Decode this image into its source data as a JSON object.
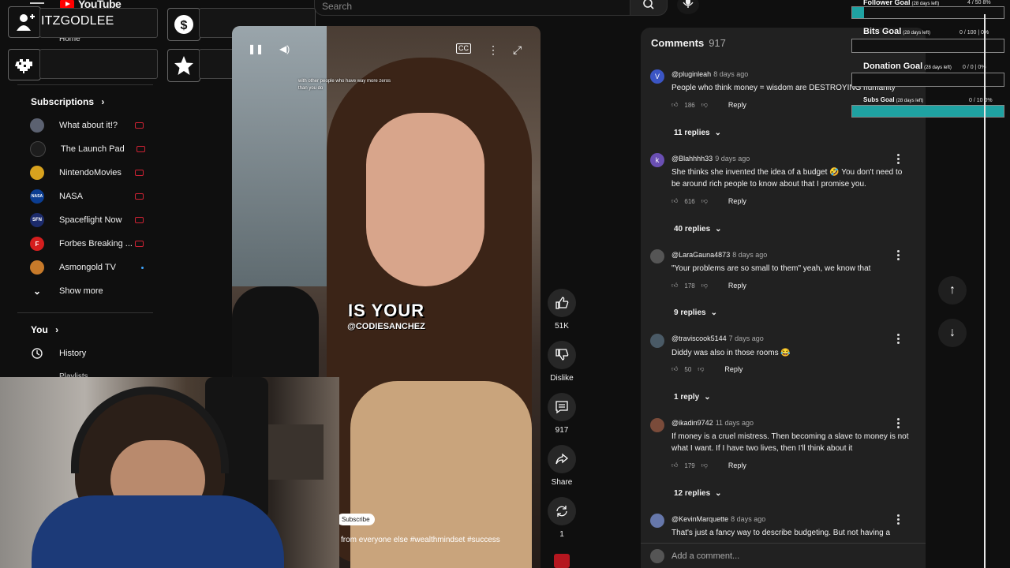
{
  "topbar": {
    "logo_text": "YouTube",
    "search_placeholder": "Search"
  },
  "overlay": {
    "channel_name": "ITZGODLEE"
  },
  "sidebar": {
    "home_label": "Home",
    "subscriptions_header": "Subscriptions",
    "subscriptions": [
      {
        "name": "What about it!?",
        "status": "live",
        "avatar_color": "#5b6170",
        "avatar_text": ""
      },
      {
        "name": "The Launch Pad",
        "status": "live",
        "avatar_color": "#1d1d1d",
        "avatar_text": ""
      },
      {
        "name": "NintendoMovies",
        "status": "live",
        "avatar_color": "#d8a21e",
        "avatar_text": ""
      },
      {
        "name": "NASA",
        "status": "live",
        "avatar_color": "#0b3d91",
        "avatar_text": "NASA"
      },
      {
        "name": "Spaceflight Now",
        "status": "live",
        "avatar_color": "#1c2b6b",
        "avatar_text": "SFN"
      },
      {
        "name": "Forbes Breaking ...",
        "status": "live",
        "avatar_color": "#d41e1e",
        "avatar_text": "F"
      },
      {
        "name": "Asmongold TV",
        "status": "new",
        "avatar_color": "#c77a2a",
        "avatar_text": ""
      }
    ],
    "show_more_label": "Show more",
    "you_header": "You",
    "history_label": "History",
    "playlists_label": "Playlists"
  },
  "video": {
    "caption_line": "IS YOUR",
    "handle": "@CODIESANCHEZ",
    "quote_text": "with other people who have way more zeros than you do",
    "subscribe_label": "Subscribe",
    "description": "from everyone else #wealthmindset #success"
  },
  "actions": {
    "like_count": "51K",
    "dislike_label": "Dislike",
    "comments_count": "917",
    "share_label": "Share",
    "remix_count": "1"
  },
  "comments": {
    "title": "Comments",
    "count": "917",
    "items": [
      {
        "user": "@pluginleah",
        "ago": "8 days ago",
        "text": "People who think money = wisdom are DESTROYING humanity",
        "likes": "186",
        "reply_label": "Reply",
        "replies": "11 replies",
        "avatar_color": "#3b55c4",
        "avatar_letter": "V"
      },
      {
        "user": "@Blahhhh33",
        "ago": "9 days ago",
        "text": "She thinks she invented the idea of a budget 🤣 You don't need to be around rich people to know about that I promise you.",
        "likes": "616",
        "reply_label": "Reply",
        "replies": "40 replies",
        "avatar_color": "#6a4fb3",
        "avatar_letter": "k"
      },
      {
        "user": "@LaraGauna4873",
        "ago": "8 days ago",
        "text": "\"Your problems are so small to them\" yeah, we know that",
        "likes": "178",
        "reply_label": "Reply",
        "replies": "9 replies",
        "avatar_color": "#555",
        "avatar_letter": ""
      },
      {
        "user": "@traviscook5144",
        "ago": "7 days ago",
        "text": "Diddy was also in those rooms 😂",
        "likes": "50",
        "reply_label": "Reply",
        "replies": "1 reply",
        "avatar_color": "#4a5a66",
        "avatar_letter": ""
      },
      {
        "user": "@ikadin9742",
        "ago": "11 days ago",
        "text": "If money is a cruel mistress. Then becoming a slave to money is not what I want. If I have two lives, then I'll think about it",
        "likes": "179",
        "reply_label": "Reply",
        "replies": "12 replies",
        "avatar_color": "#7a4b3a",
        "avatar_letter": ""
      },
      {
        "user": "@KevinMarquette",
        "ago": "8 days ago",
        "text": "That's just a fancy way to describe budgeting. But not having a",
        "likes": "",
        "reply_label": "",
        "replies": "",
        "avatar_color": "#6677aa",
        "avatar_letter": ""
      }
    ],
    "add_placeholder": "Add a comment..."
  },
  "goals": {
    "follower": {
      "label": "Follower Goal",
      "days": "(28 days left)",
      "value": "4 / 50 8%",
      "fill": 0.08
    },
    "bits": {
      "label": "Bits Goal",
      "days": "(28 days left)",
      "value": "0 / 100 | 0%",
      "fill": 0
    },
    "donation": {
      "label": "Donation Goal",
      "days": "(28 days left)",
      "value": "0 / 0 | 0%",
      "fill": 0
    },
    "subs": {
      "label": "Subs Goal",
      "days": "(28 days left)",
      "value": "0 / 10 0%",
      "fill": 1.0
    }
  },
  "colors": {
    "accent_teal": "#1fa2a2",
    "live_red": "#cc2233",
    "yt_red": "#ff0000"
  }
}
